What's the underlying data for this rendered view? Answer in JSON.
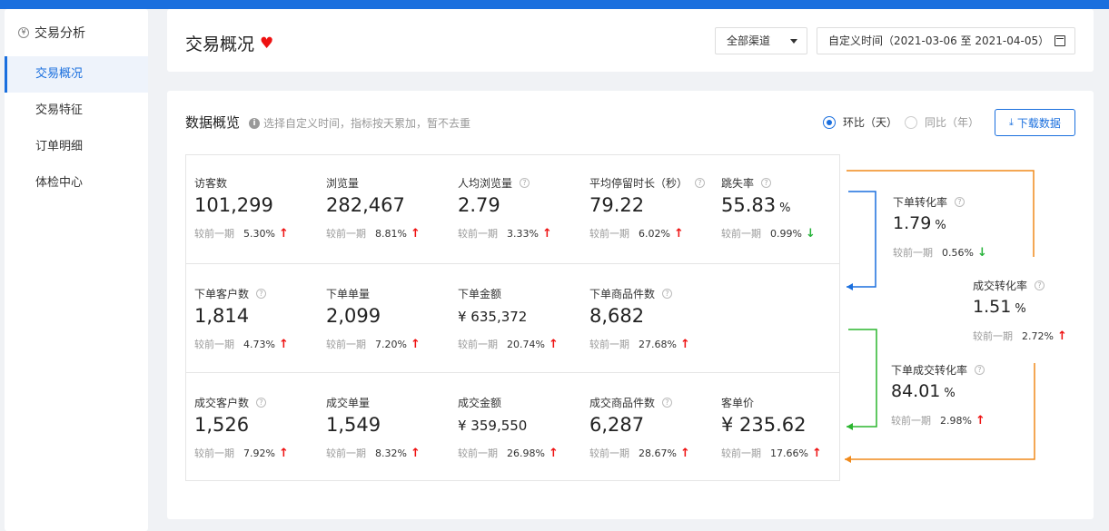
{
  "colors": {
    "accent": "#1a6fde",
    "up": "#e11111",
    "down": "#27b33b",
    "orange": "#f08a1c",
    "green": "#2bb52f"
  },
  "sidebar": {
    "title": "交易分析",
    "items": [
      {
        "label": "交易概况",
        "active": true
      },
      {
        "label": "交易特征"
      },
      {
        "label": "订单明细"
      },
      {
        "label": "体检中心"
      }
    ]
  },
  "header": {
    "title": "交易概况",
    "channel": "全部渠道",
    "date_range": "自定义时间（2021-03-06 至 2021-04-05）"
  },
  "overview": {
    "title": "数据概览",
    "hint": "选择自定义时间，指标按天累加，暂不去重",
    "radio_mom": "环比（天）",
    "radio_yoy": "同比（年）",
    "download": "下载数据",
    "compare_label": "较前一期"
  },
  "metrics": {
    "visitors": {
      "label": "访客数",
      "value": "101,299",
      "pct": "5.30%",
      "trend": "up"
    },
    "views": {
      "label": "浏览量",
      "value": "282,467",
      "pct": "8.81%",
      "trend": "up"
    },
    "per_capita": {
      "label": "人均浏览量",
      "value": "2.79",
      "pct": "3.33%",
      "trend": "up"
    },
    "avg_stay": {
      "label": "平均停留时长（秒）",
      "value": "79.22",
      "pct": "6.02%",
      "trend": "up"
    },
    "bounce": {
      "label": "跳失率",
      "value": "55.83",
      "unit": "%",
      "pct": "0.99%",
      "trend": "down"
    },
    "order_customers": {
      "label": "下单客户数",
      "value": "1,814",
      "pct": "4.73%",
      "trend": "up"
    },
    "orders": {
      "label": "下单单量",
      "value": "2,099",
      "pct": "7.20%",
      "trend": "up"
    },
    "order_amount": {
      "label": "下单金额",
      "value": "¥ 635,372",
      "pct": "20.74%",
      "trend": "up"
    },
    "order_items": {
      "label": "下单商品件数",
      "value": "8,682",
      "pct": "27.68%",
      "trend": "up"
    },
    "deal_customers": {
      "label": "成交客户数",
      "value": "1,526",
      "pct": "7.92%",
      "trend": "up"
    },
    "deals": {
      "label": "成交单量",
      "value": "1,549",
      "pct": "8.32%",
      "trend": "up"
    },
    "deal_amount": {
      "label": "成交金额",
      "value": "¥ 359,550",
      "pct": "26.98%",
      "trend": "up"
    },
    "deal_items": {
      "label": "成交商品件数",
      "value": "6,287",
      "pct": "28.67%",
      "trend": "up"
    },
    "unit_price": {
      "label": "客单价",
      "value": "¥ 235.62",
      "pct": "17.66%",
      "trend": "up"
    }
  },
  "funnel": {
    "order_conv": {
      "label": "下单转化率",
      "value": "1.79",
      "unit": "%",
      "pct": "0.56%",
      "trend": "down"
    },
    "deal_conv": {
      "label": "成交转化率",
      "value": "1.51",
      "unit": "%",
      "pct": "2.72%",
      "trend": "up"
    },
    "order_deal_conv": {
      "label": "下单成交转化率",
      "value": "84.01",
      "unit": "%",
      "pct": "2.98%",
      "trend": "up"
    }
  },
  "glyphs": {
    "help": "?",
    "info": "i",
    "heart": "♥",
    "up": "↑",
    "down": "↓",
    "yen_icon": "¥",
    "download_icon": "⤓"
  }
}
